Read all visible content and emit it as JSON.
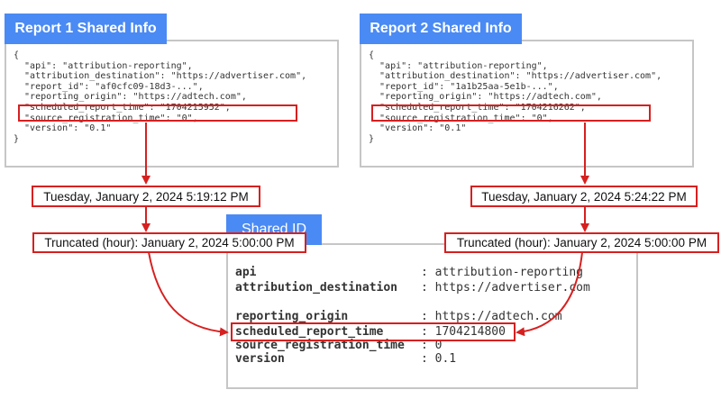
{
  "report1": {
    "title": "Report 1 Shared Info",
    "lines": [
      "{",
      "  \"api\": \"attribution-reporting\",",
      "  \"attribution_destination\": \"https://advertiser.com\",",
      "  \"report_id\": \"af0cfc09-18d3-...\",",
      "  \"reporting_origin\": \"https://adtech.com\",",
      "  \"scheduled_report_time\": \"1704215952\",",
      "  \"source_registration_time\": \"0\",",
      "  \"version\": \"0.1\"",
      "}"
    ],
    "date": "Tuesday, January 2, 2024 5:19:12 PM",
    "truncated": "Truncated (hour): January 2, 2024 5:00:00 PM"
  },
  "report2": {
    "title": "Report 2 Shared Info",
    "lines": [
      "{",
      "  \"api\": \"attribution-reporting\",",
      "  \"attribution_destination\": \"https://advertiser.com\",",
      "  \"report_id\": \"1a1b25aa-5e1b-...\",",
      "  \"reporting_origin\": \"https://adtech.com\",",
      "  \"scheduled_report_time\": \"1704216262\",",
      "  \"source_registration_time\": \"0\",",
      "  \"version\": \"0.1\"",
      "}"
    ],
    "date": "Tuesday, January 2, 2024 5:24:22 PM",
    "truncated": "Truncated (hour): January 2, 2024 5:00:00 PM"
  },
  "shared_id": {
    "title": "Shared ID",
    "rows": [
      {
        "key": "api",
        "value": ": attribution-reporting"
      },
      {
        "key": "attribution_destination",
        "value": ": https://advertiser.com"
      },
      {
        "key": "reporting_origin",
        "value": ": https://adtech.com"
      },
      {
        "key": "scheduled_report_time",
        "value": ": 1704214800"
      },
      {
        "key": "source_registration_time",
        "value": ": 0"
      },
      {
        "key": "version",
        "value": ": 0.1"
      }
    ]
  },
  "colors": {
    "tab": "#4a8af4",
    "highlight": "#d62020",
    "panel_border": "#c6c6c6"
  }
}
